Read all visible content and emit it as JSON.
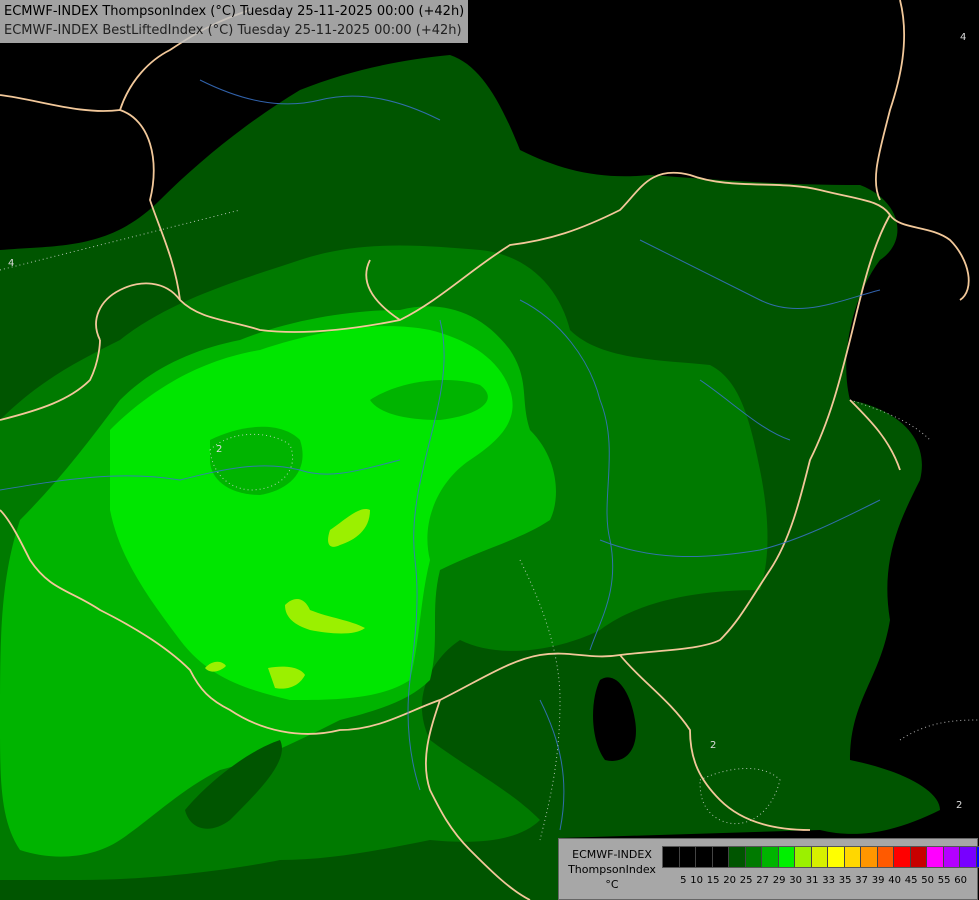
{
  "header": {
    "line1": "ECMWF-INDEX ThompsonIndex (°C) Tuesday 25-11-2025 00:00 (+42h)",
    "line2": "ECMWF-INDEX BestLiftedIndex (°C) Tuesday 25-11-2025 00:00 (+42h)"
  },
  "legend": {
    "line1": "ECMWF-INDEX",
    "line2": "ThompsonIndex",
    "line3": "°C",
    "colors": [
      "#000000",
      "#000000",
      "#000000",
      "#000000",
      "#005500",
      "#007a00",
      "#00b400",
      "#00f000",
      "#9bf000",
      "#d7f000",
      "#ffff00",
      "#ffd700",
      "#ff9600",
      "#ff5a00",
      "#ff0000",
      "#c80000",
      "#ff00ff",
      "#b400ff",
      "#7800ff",
      "#0000ff"
    ],
    "ticks": [
      "5",
      "10",
      "15",
      "20",
      "25",
      "27",
      "29",
      "30",
      "31",
      "33",
      "35",
      "37",
      "39",
      "40",
      "45",
      "50",
      "55",
      "60"
    ]
  },
  "contour_labels": [
    "4",
    "2",
    "4",
    "2",
    "2"
  ]
}
